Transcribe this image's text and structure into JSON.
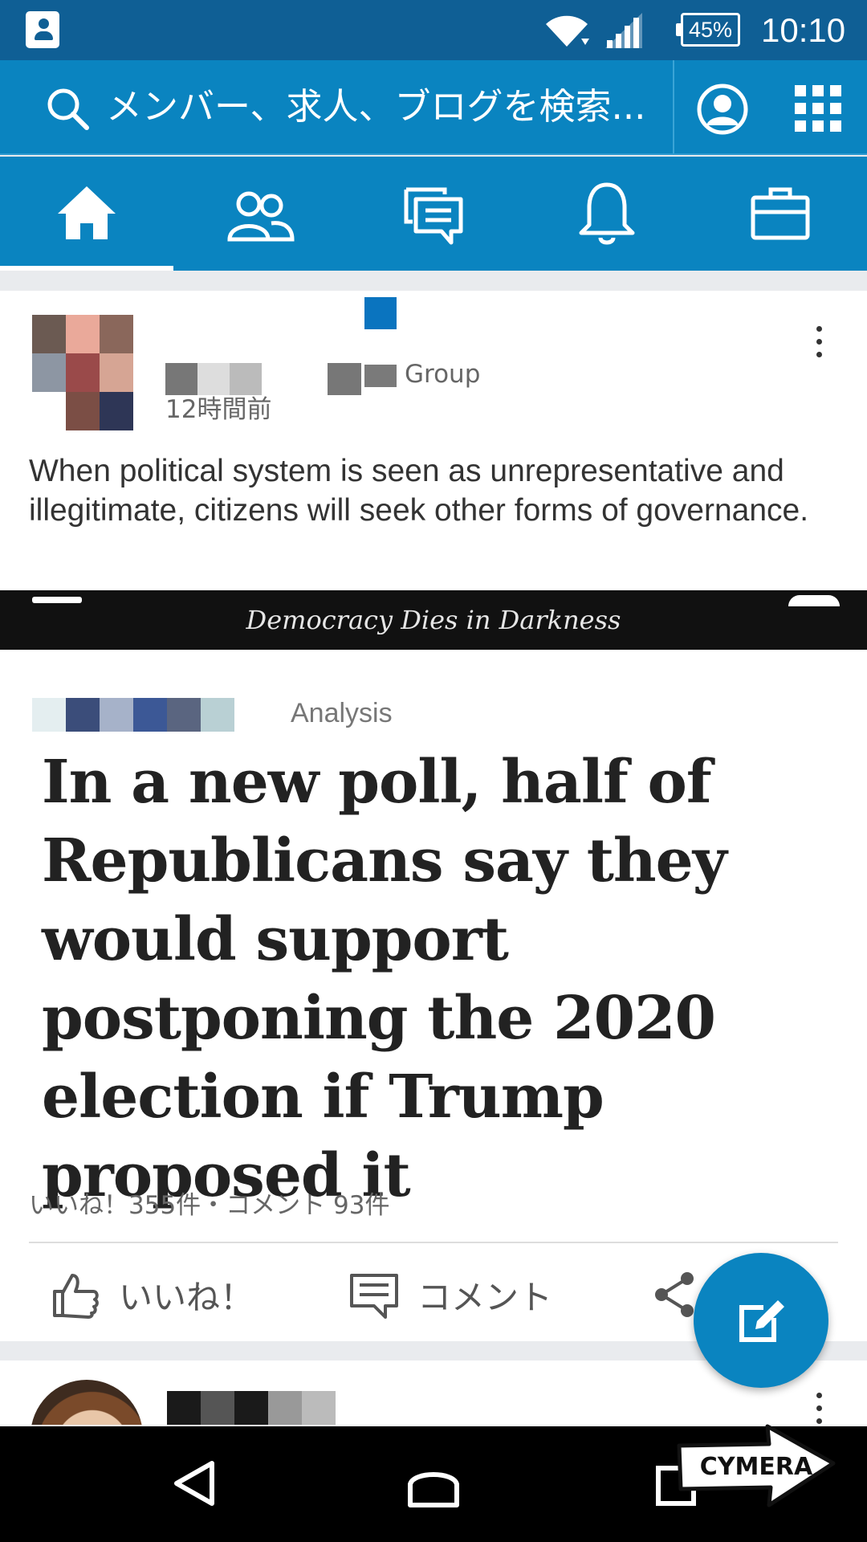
{
  "status_bar": {
    "battery": "45%",
    "time": "10:10"
  },
  "search": {
    "placeholder": "メンバー、求人、ブログを検索..."
  },
  "nav_tabs": [
    {
      "icon": "home-icon",
      "active": true
    },
    {
      "icon": "people-icon",
      "active": false
    },
    {
      "icon": "messages-icon",
      "active": false
    },
    {
      "icon": "bell-icon",
      "active": false
    },
    {
      "icon": "briefcase-icon",
      "active": false
    }
  ],
  "post": {
    "group_label": "Group",
    "time": "12時間前",
    "text": "When political system is seen as unrepresentative and illegitimate, citizens will seek other forms of governance.",
    "article": {
      "tagline": "Democracy Dies in Darkness",
      "kicker": "Analysis",
      "headline": "In a new poll, half of Republicans say they would support postponing the 2020 election if Trump proposed it"
    },
    "counts": "いいね！355件・コメント 93件",
    "actions": {
      "like": "いいね！",
      "comment": "コメント"
    }
  },
  "watermark": "CYMERA",
  "colors": {
    "brand": "#0a84c0",
    "status_bar": "#0f5f95"
  }
}
